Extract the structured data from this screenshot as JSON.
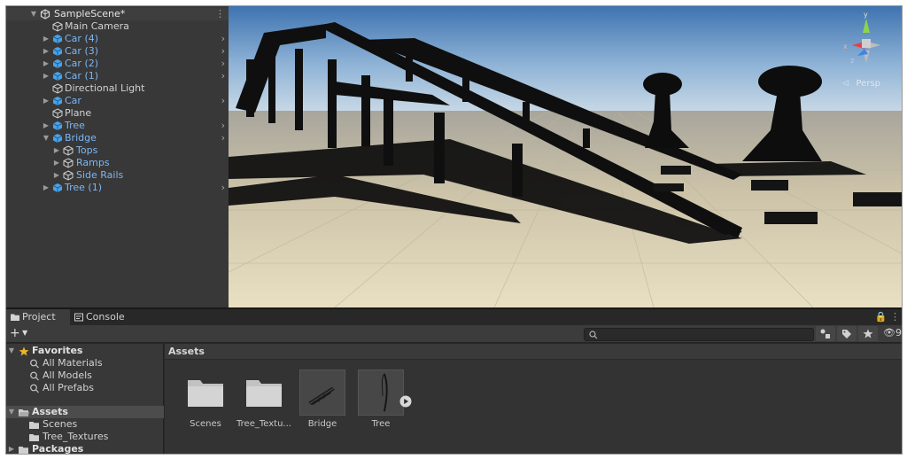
{
  "hierarchy": {
    "scene_name": "SampleScene*",
    "items": [
      {
        "label": "Main Camera",
        "kind": "normal"
      },
      {
        "label": "Car (4)",
        "kind": "prefab"
      },
      {
        "label": "Car (3)",
        "kind": "prefab"
      },
      {
        "label": "Car (2)",
        "kind": "prefab"
      },
      {
        "label": "Car (1)",
        "kind": "prefab"
      },
      {
        "label": "Directional Light",
        "kind": "normal"
      },
      {
        "label": "Car",
        "kind": "prefab"
      },
      {
        "label": "Plane",
        "kind": "normal"
      },
      {
        "label": "Tree",
        "kind": "prefab"
      },
      {
        "label": "Bridge",
        "kind": "prefab"
      },
      {
        "label": "Tops",
        "kind": "prefab"
      },
      {
        "label": "Ramps",
        "kind": "prefab"
      },
      {
        "label": "Side Rails",
        "kind": "prefab"
      },
      {
        "label": "Tree (1)",
        "kind": "prefab"
      }
    ]
  },
  "scene_view": {
    "projection_label": "Persp",
    "gizmo_axes": [
      "y",
      "x",
      "z"
    ]
  },
  "bottom_panel": {
    "tabs": [
      "Project",
      "Console"
    ],
    "active_tab": "Project",
    "hidden_count": "9",
    "favorites": {
      "label": "Favorites",
      "items": [
        "All Materials",
        "All Models",
        "All Prefabs"
      ]
    },
    "assets_root": {
      "label": "Assets",
      "children": [
        "Scenes",
        "Tree_Textures"
      ]
    },
    "packages": {
      "label": "Packages"
    },
    "assets_header": "Assets",
    "assets": [
      {
        "name": "Scenes",
        "type": "folder"
      },
      {
        "name": "Tree_Textu...",
        "type": "folder"
      },
      {
        "name": "Bridge",
        "type": "prefab"
      },
      {
        "name": "Tree",
        "type": "prefab"
      }
    ]
  },
  "colors": {
    "prefab_text": "#7cb6f4",
    "prefab_icon": "#4aa3e8",
    "favorite_star": "#f0b429",
    "gizmo_y": "#8ed44a",
    "gizmo_x": "#e4414b",
    "gizmo_z": "#3d86e8"
  }
}
